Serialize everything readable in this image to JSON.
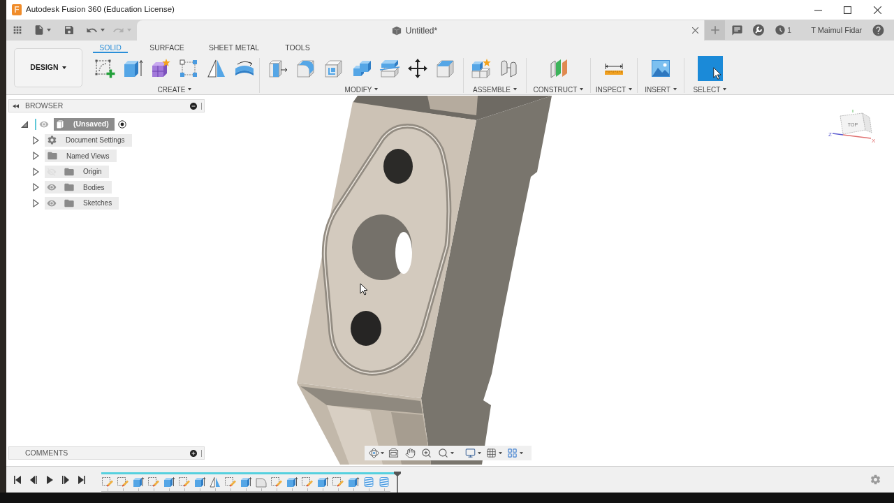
{
  "window": {
    "logo": "F",
    "title": "Autodesk Fusion 360 (Education License)"
  },
  "history": [
    {
      "kind": "undo",
      "disabled": false
    },
    {
      "kind": "redo",
      "disabled": true
    }
  ],
  "document_tab": {
    "title": "Untitled*"
  },
  "account": {
    "job_count": "1",
    "user": "T Maimul Fidar"
  },
  "workspace": {
    "label": "DESIGN"
  },
  "tabs": [
    {
      "label": "SOLID",
      "selected": true
    },
    {
      "label": "SURFACE",
      "selected": false
    },
    {
      "label": "SHEET METAL",
      "selected": false
    },
    {
      "label": "TOOLS",
      "selected": false
    }
  ],
  "tool_groups": [
    {
      "label": "CREATE"
    },
    {
      "label": "MODIFY"
    },
    {
      "label": "ASSEMBLE"
    },
    {
      "label": "CONSTRUCT"
    },
    {
      "label": "INSPECT"
    },
    {
      "label": "INSERT"
    },
    {
      "label": "SELECT"
    }
  ],
  "browser": {
    "title": "BROWSER",
    "root": {
      "label": "(Unsaved)",
      "expanded": true,
      "active": true,
      "selected": true
    },
    "items": [
      {
        "label": "Document Settings",
        "kind": "settings",
        "selected": false,
        "expanded": false
      },
      {
        "label": "Named Views",
        "kind": "folder",
        "selected": false,
        "expanded": false
      },
      {
        "label": "Origin",
        "kind": "layer",
        "visible": false,
        "selected": false,
        "expanded": false
      },
      {
        "label": "Bodies",
        "kind": "layer",
        "visible": true,
        "selected": false,
        "expanded": false
      },
      {
        "label": "Sketches",
        "kind": "layer",
        "visible": true,
        "selected": false,
        "expanded": false
      }
    ]
  },
  "view_cube": {
    "face": "TOP",
    "axes": [
      "Z",
      "X"
    ]
  },
  "comments": {
    "title": "COMMENTS"
  },
  "timeline": {
    "features": [
      {
        "kind": "sketch"
      },
      {
        "kind": "sketch"
      },
      {
        "kind": "extrude"
      },
      {
        "kind": "sketch"
      },
      {
        "kind": "extrude"
      },
      {
        "kind": "sketch"
      },
      {
        "kind": "extrude"
      },
      {
        "kind": "mirror"
      },
      {
        "kind": "sketch"
      },
      {
        "kind": "extrude"
      },
      {
        "kind": "fillet"
      },
      {
        "kind": "sketch"
      },
      {
        "kind": "extrude"
      },
      {
        "kind": "sketch"
      },
      {
        "kind": "extrude"
      },
      {
        "kind": "sketch"
      },
      {
        "kind": "extrude"
      },
      {
        "kind": "thread"
      },
      {
        "kind": "thread"
      }
    ]
  }
}
